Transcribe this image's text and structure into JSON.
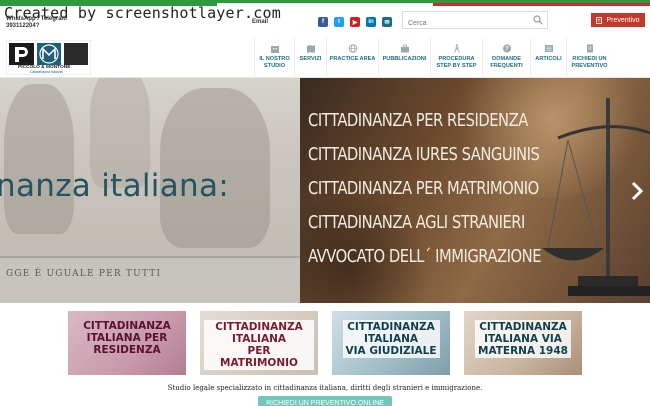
{
  "watermark": "Created by screenshotlayer.com",
  "topbar": {
    "contact_line1": "WhatsApp / Telegram",
    "contact_line2": "393112204?",
    "email_label": "Email",
    "social": [
      {
        "name": "facebook-icon",
        "glyph": "f",
        "color": "#3b5998"
      },
      {
        "name": "twitter-icon",
        "glyph": "t",
        "color": "#1da1f2"
      },
      {
        "name": "youtube-icon",
        "glyph": "▶",
        "color": "#cd201f"
      },
      {
        "name": "linkedin-icon",
        "glyph": "in",
        "color": "#0077b5"
      },
      {
        "name": "email-icon",
        "glyph": "✉",
        "color": "#1a6e86"
      }
    ],
    "search_placeholder": "Cerca",
    "preventivo_label": "Preventivo",
    "preventivo_color": "#c0392b"
  },
  "logo": {
    "name": "PICCOLO & MONTONE",
    "tagline": "Cittadinanza Italiana"
  },
  "nav": [
    {
      "id": "studio",
      "label_1": "IL NOSTRO",
      "label_2": "STUDIO"
    },
    {
      "id": "servizi",
      "label_1": "SERVIZI",
      "label_2": ""
    },
    {
      "id": "practice",
      "label_1": "PRACTICE AREA",
      "label_2": ""
    },
    {
      "id": "pubblicazioni",
      "label_1": "PUBBLICAZIONI",
      "label_2": ""
    },
    {
      "id": "procedura",
      "label_1": "PROCEDURA",
      "label_2": "STEP BY STEP"
    },
    {
      "id": "domande",
      "label_1": "DOMANDE",
      "label_2": "FREQUENTI"
    },
    {
      "id": "articoli",
      "label_1": "ARTICOLI",
      "label_2": ""
    },
    {
      "id": "richiedi",
      "label_1": "RICHIEDI UN",
      "label_2": "PREVENTIVO"
    }
  ],
  "hero": {
    "headline": "nanza italiana:",
    "legge": "GGE È UGUALE PER TUTTI",
    "lines": [
      "CITTADINANZA PER RESIDENZA",
      "CITTADINANZA  IURES SANGUINIS",
      "CITTADINANZA PER MATRIMONIO",
      "CITTADINANZA AGLI STRANIERI",
      "AVVOCATO DELL´ IMMIGRAZIONE"
    ]
  },
  "cards": [
    {
      "line1": "CITTADINANZA",
      "line2": "ITALIANA PER",
      "line3": "RESIDENZA"
    },
    {
      "line1": "CITTADINANZA",
      "line2": "ITALIANA",
      "line3": "PER MATRIMONIO"
    },
    {
      "line1": "CITTADINANZA",
      "line2": "ITALIANA",
      "line3": "VIA GIUDIZIALE"
    },
    {
      "line1": "CITTADINANZA",
      "line2": "ITALIANA VIA",
      "line3": "MATERNA 1948"
    }
  ],
  "footer": {
    "text": "Studio legale specializzato in cittadinanza italiana, diritti degli stranieri e immigrazione.",
    "cta": "RICHIEDI UN PREVENTIVO ONLINE"
  },
  "colors": {
    "accent": "#1a6e86",
    "cta": "#72c8b8",
    "flag_green": "#2e9a3e",
    "flag_white": "#ffffff",
    "flag_red": "#ce2b37"
  }
}
